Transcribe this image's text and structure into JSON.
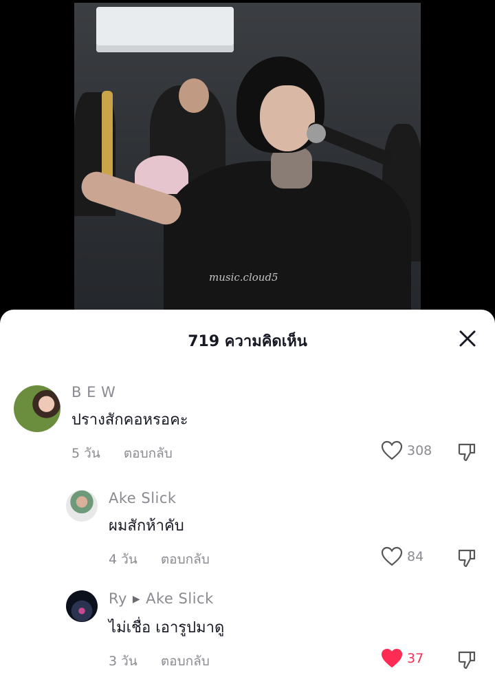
{
  "video": {
    "watermark": "music.cloud5"
  },
  "sheet": {
    "title": "719 ความคิดเห็น",
    "close_icon": "close-icon"
  },
  "comments": [
    {
      "username": "B E W",
      "text": "ปรางสักคอหรอคะ",
      "time": "5 วัน",
      "reply_label": "ตอบกลับ",
      "likes": "308",
      "liked": false
    },
    {
      "username": "Ake Slick",
      "text": "ผมสักห้าคับ",
      "time": "4 วัน",
      "reply_label": "ตอบกลับ",
      "likes": "84",
      "liked": false
    },
    {
      "username": "Ry",
      "reply_to": "Ake Slick",
      "text": "ไม่เชื่อ เอารูปมาดู",
      "time": "3 วัน",
      "reply_label": "ตอบกลับ",
      "likes": "37",
      "liked": true
    }
  ],
  "colors": {
    "like_active": "#fe2c55",
    "secondary_text": "#8a8b91",
    "primary_text": "#161823"
  }
}
